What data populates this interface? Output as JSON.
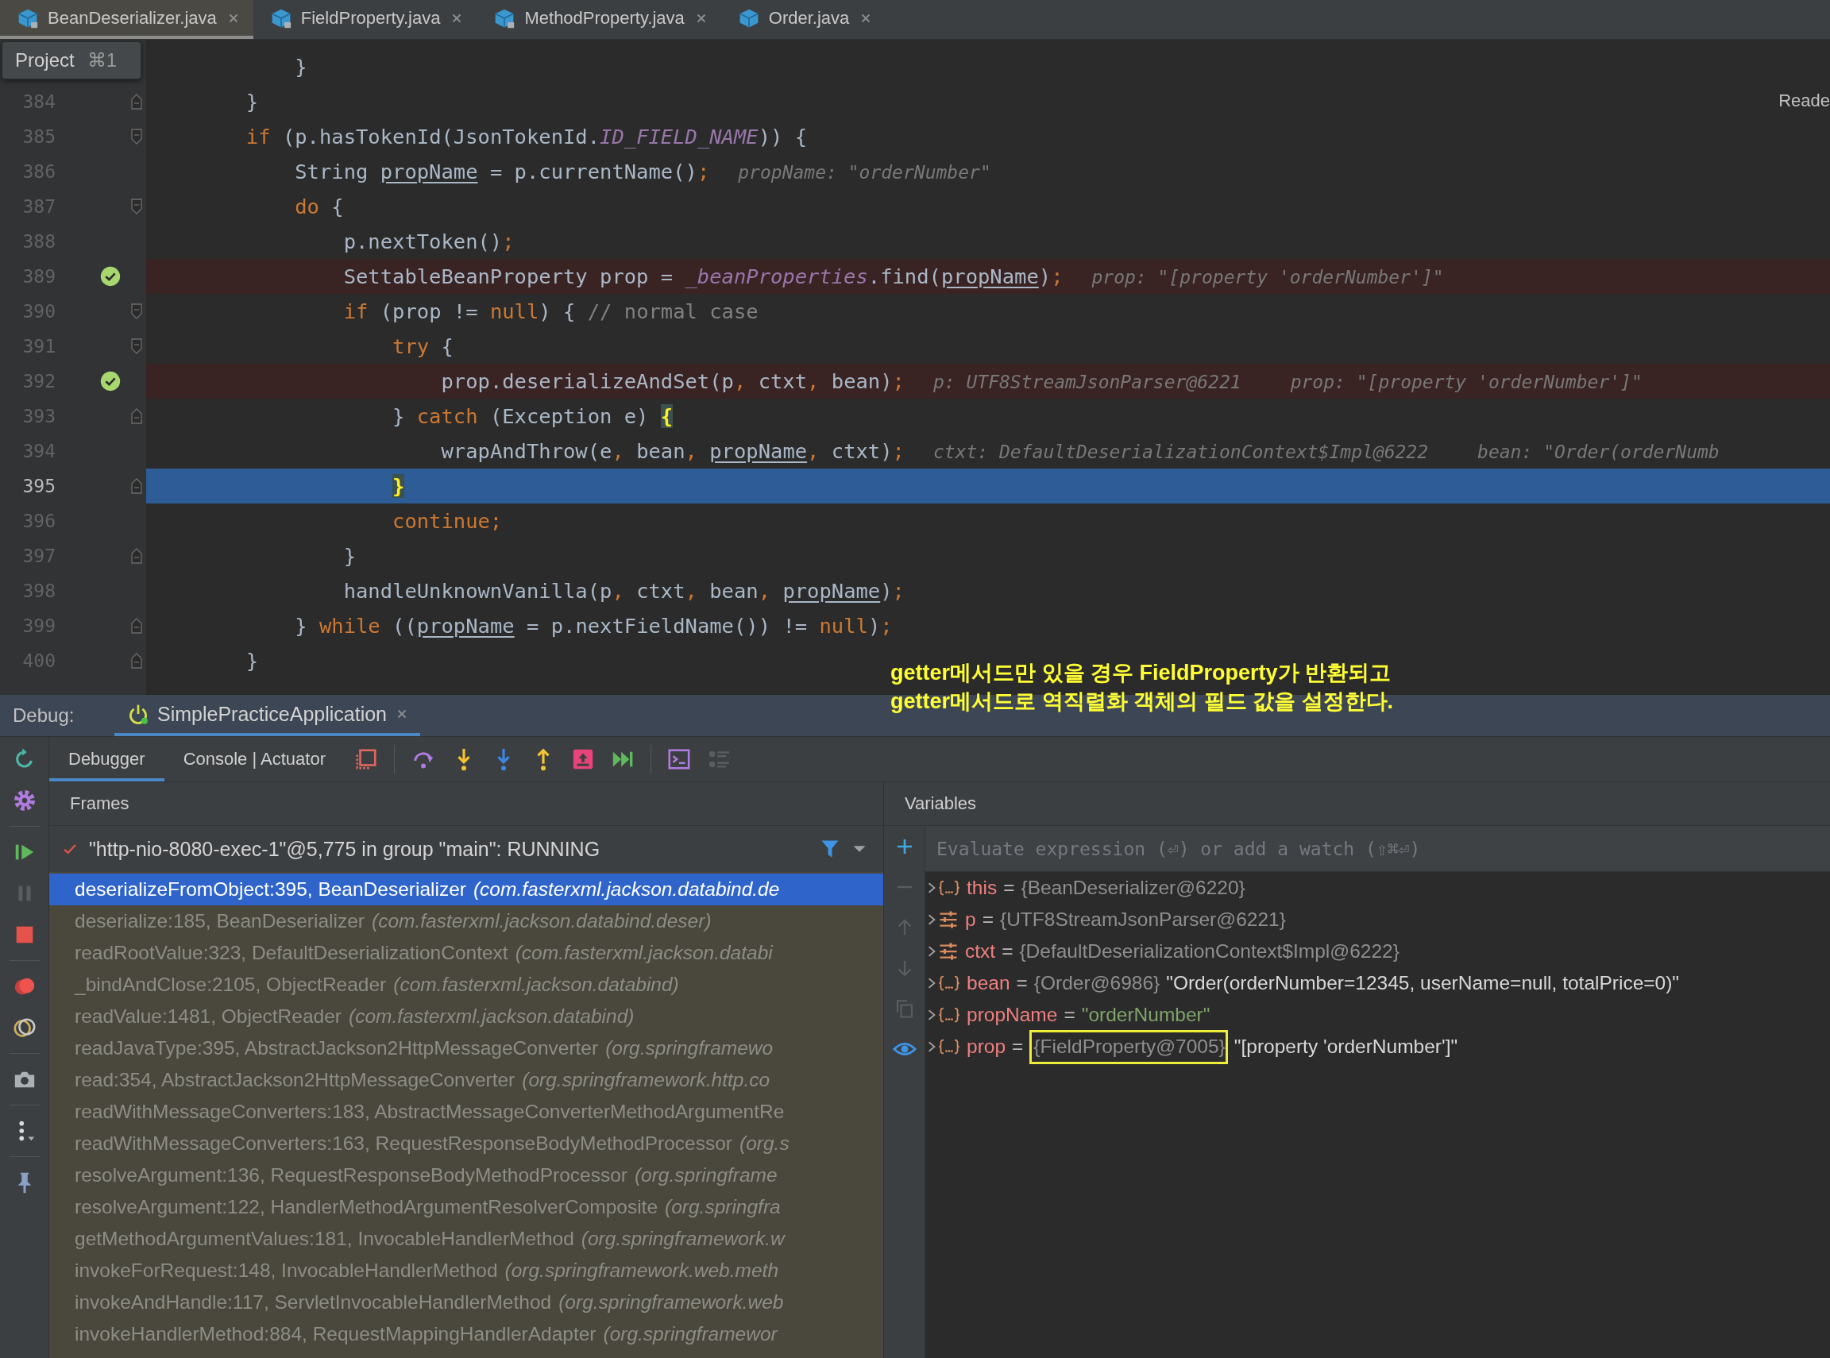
{
  "tabs": [
    {
      "label": "BeanDeserializer.java",
      "selected": true,
      "locked": true
    },
    {
      "label": "FieldProperty.java",
      "selected": false,
      "locked": true
    },
    {
      "label": "MethodProperty.java",
      "selected": false,
      "locked": true
    },
    {
      "label": "Order.java",
      "selected": false,
      "locked": false
    }
  ],
  "tooltip": {
    "label": "Project",
    "shortcut": "⌘1"
  },
  "reader_mode": "Reade",
  "code_lines": [
    {
      "breakpoint": false,
      "current": false,
      "segments": [
        {
          "kind": "plain",
          "text": "            }"
        }
      ]
    },
    {
      "number": "384",
      "fold": {
        "kind": "end"
      },
      "breakpoint": false,
      "current": false,
      "segments": [
        {
          "kind": "plain",
          "text": "        }"
        }
      ]
    },
    {
      "number": "385",
      "fold": {
        "kind": "start"
      },
      "breakpoint": false,
      "current": false,
      "segments": [
        {
          "kind": "keyword",
          "text": "        if"
        },
        {
          "kind": "plain",
          "text": " (p.hasTokenId(JsonTokenId."
        },
        {
          "kind": "static",
          "text": "ID_FIELD_NAME"
        },
        {
          "kind": "plain",
          "text": ")) {"
        }
      ]
    },
    {
      "number": "386",
      "breakpoint": false,
      "current": false,
      "segments": [
        {
          "kind": "plain",
          "text": "            String "
        },
        {
          "kind": "underlined",
          "text": "propName"
        },
        {
          "kind": "plain",
          "text": " = p.currentName()"
        },
        {
          "kind": "keyword",
          "text": ";"
        },
        {
          "kind": "hint",
          "text": "propName: \"orderNumber\""
        }
      ]
    },
    {
      "number": "387",
      "fold": {
        "kind": "start"
      },
      "breakpoint": false,
      "current": false,
      "segments": [
        {
          "kind": "keyword",
          "text": "            do"
        },
        {
          "kind": "plain",
          "text": " {"
        }
      ]
    },
    {
      "number": "388",
      "breakpoint": false,
      "current": false,
      "segments": [
        {
          "kind": "plain",
          "text": "                p.nextToken()"
        },
        {
          "kind": "keyword",
          "text": ";"
        }
      ]
    },
    {
      "number": "389",
      "breakpoint": true,
      "current": false,
      "segments": [
        {
          "kind": "plain",
          "text": "                SettableBeanProperty prop = "
        },
        {
          "kind": "static",
          "text": "_beanProperties"
        },
        {
          "kind": "plain",
          "text": ".find("
        },
        {
          "kind": "underlined",
          "text": "propName"
        },
        {
          "kind": "plain",
          "text": ")"
        },
        {
          "kind": "keyword",
          "text": ";"
        },
        {
          "kind": "hint",
          "text": "prop: \"[property 'orderNumber']\""
        }
      ]
    },
    {
      "number": "390",
      "fold": {
        "kind": "start"
      },
      "breakpoint": false,
      "current": false,
      "segments": [
        {
          "kind": "keyword",
          "text": "                if"
        },
        {
          "kind": "plain",
          "text": " (prop != "
        },
        {
          "kind": "keyword",
          "text": "null"
        },
        {
          "kind": "plain",
          "text": ") { "
        },
        {
          "kind": "comment",
          "text": "// normal case"
        }
      ]
    },
    {
      "number": "391",
      "fold": {
        "kind": "start"
      },
      "breakpoint": false,
      "current": false,
      "segments": [
        {
          "kind": "keyword",
          "text": "                    try"
        },
        {
          "kind": "plain",
          "text": " {"
        }
      ]
    },
    {
      "number": "392",
      "breakpoint": true,
      "current": false,
      "segments": [
        {
          "kind": "plain",
          "text": "                        prop.deserializeAndSet(p"
        },
        {
          "kind": "keyword",
          "text": ","
        },
        {
          "kind": "plain",
          "text": " ctxt"
        },
        {
          "kind": "keyword",
          "text": ","
        },
        {
          "kind": "plain",
          "text": " bean)"
        },
        {
          "kind": "keyword",
          "text": ";"
        },
        {
          "kind": "hint",
          "text": "p: UTF8StreamJsonParser@6221"
        },
        {
          "kind": "hint",
          "text": "prop: \"[property 'orderNumber']\""
        }
      ]
    },
    {
      "number": "393",
      "fold": {
        "kind": "end"
      },
      "breakpoint": false,
      "current": false,
      "segments": [
        {
          "kind": "plain",
          "text": "                    } "
        },
        {
          "kind": "keyword",
          "text": "catch"
        },
        {
          "kind": "plain",
          "text": " (Exception e) "
        },
        {
          "kind": "brace",
          "text": "{"
        }
      ]
    },
    {
      "number": "394",
      "breakpoint": false,
      "current": false,
      "segments": [
        {
          "kind": "plain",
          "text": "                        wrapAndThrow(e"
        },
        {
          "kind": "keyword",
          "text": ","
        },
        {
          "kind": "plain",
          "text": " bean"
        },
        {
          "kind": "keyword",
          "text": ","
        },
        {
          "kind": "underlined",
          "text": " propName"
        },
        {
          "kind": "keyword",
          "text": ","
        },
        {
          "kind": "plain",
          "text": " ctxt)"
        },
        {
          "kind": "keyword",
          "text": ";"
        },
        {
          "kind": "hint",
          "text": "ctxt: DefaultDeserializationContext$Impl@6222"
        },
        {
          "kind": "hint",
          "text": "bean: \"Order(orderNumb"
        }
      ]
    },
    {
      "number": "395",
      "fold": {
        "kind": "end"
      },
      "breakpoint": false,
      "current": true,
      "segments": [
        {
          "kind": "brace",
          "text": "                    }"
        }
      ]
    },
    {
      "number": "396",
      "breakpoint": false,
      "current": false,
      "segments": [
        {
          "kind": "keyword",
          "text": "                    continue;"
        }
      ]
    },
    {
      "number": "397",
      "fold": {
        "kind": "end"
      },
      "breakpoint": false,
      "current": false,
      "segments": [
        {
          "kind": "plain",
          "text": "                }"
        }
      ]
    },
    {
      "number": "398",
      "breakpoint": false,
      "current": false,
      "segments": [
        {
          "kind": "plain",
          "text": "                handleUnknownVanilla(p"
        },
        {
          "kind": "keyword",
          "text": ","
        },
        {
          "kind": "plain",
          "text": " ctxt"
        },
        {
          "kind": "keyword",
          "text": ","
        },
        {
          "kind": "plain",
          "text": " bean"
        },
        {
          "kind": "keyword",
          "text": ","
        },
        {
          "kind": "underlined",
          "text": " propName"
        },
        {
          "kind": "plain",
          "text": ")"
        },
        {
          "kind": "keyword",
          "text": ";"
        }
      ]
    },
    {
      "number": "399",
      "fold": {
        "kind": "end"
      },
      "breakpoint": false,
      "current": false,
      "segments": [
        {
          "kind": "plain",
          "text": "            } "
        },
        {
          "kind": "keyword",
          "text": "while"
        },
        {
          "kind": "plain",
          "text": " (("
        },
        {
          "kind": "underlined",
          "text": "propName"
        },
        {
          "kind": "plain",
          "text": " = p.nextFieldName()) != "
        },
        {
          "kind": "keyword",
          "text": "null"
        },
        {
          "kind": "plain",
          "text": ")"
        },
        {
          "kind": "keyword",
          "text": ";"
        }
      ]
    },
    {
      "number": "400",
      "fold": {
        "kind": "end"
      },
      "breakpoint": false,
      "current": false,
      "segments": [
        {
          "kind": "plain",
          "text": "        }"
        }
      ]
    }
  ],
  "annotation": [
    "getter메서드만 있을 경우 FieldProperty가 반환되고",
    "getter메서드로 역직렬화 객체의 필드 값을 설정한다."
  ],
  "debug": {
    "label": "Debug:",
    "session": "SimplePracticeApplication",
    "tabs": [
      {
        "label": "Debugger",
        "selected": true
      },
      {
        "label": "Console | Actuator",
        "selected": false
      }
    ]
  },
  "frames": {
    "title": "Frames",
    "thread": "\"http-nio-8080-exec-1\"@5,775 in group \"main\": RUNNING",
    "items": [
      {
        "method": "deserializeFromObject:395, BeanDeserializer",
        "package": "(com.fasterxml.jackson.databind.de",
        "selected": true
      },
      {
        "method": "deserialize:185, BeanDeserializer",
        "package": "(com.fasterxml.jackson.databind.deser)",
        "selected": false
      },
      {
        "method": "readRootValue:323, DefaultDeserializationContext",
        "package": "(com.fasterxml.jackson.databi",
        "selected": false
      },
      {
        "method": "_bindAndClose:2105, ObjectReader",
        "package": "(com.fasterxml.jackson.databind)",
        "selected": false
      },
      {
        "method": "readValue:1481, ObjectReader",
        "package": "(com.fasterxml.jackson.databind)",
        "selected": false
      },
      {
        "method": "readJavaType:395, AbstractJackson2HttpMessageConverter",
        "package": "(org.springframewo",
        "selected": false
      },
      {
        "method": "read:354, AbstractJackson2HttpMessageConverter",
        "package": "(org.springframework.http.co",
        "selected": false
      },
      {
        "method": "readWithMessageConverters:183, AbstractMessageConverterMethodArgumentRe",
        "selected": false
      },
      {
        "method": "readWithMessageConverters:163, RequestResponseBodyMethodProcessor",
        "package": "(org.s",
        "selected": false
      },
      {
        "method": "resolveArgument:136, RequestResponseBodyMethodProcessor",
        "package": "(org.springframe",
        "selected": false
      },
      {
        "method": "resolveArgument:122, HandlerMethodArgumentResolverComposite",
        "package": "(org.springfra",
        "selected": false
      },
      {
        "method": "getMethodArgumentValues:181, InvocableHandlerMethod",
        "package": "(org.springframework.w",
        "selected": false
      },
      {
        "method": "invokeForRequest:148, InvocableHandlerMethod",
        "package": "(org.springframework.web.meth",
        "selected": false
      },
      {
        "method": "invokeAndHandle:117, ServletInvocableHandlerMethod",
        "package": "(org.springframework.web",
        "selected": false
      },
      {
        "method": "invokeHandlerMethod:884, RequestMappingHandlerAdapter",
        "package": "(org.springframewor",
        "selected": false
      }
    ]
  },
  "variables": {
    "title": "Variables",
    "placeholder": "Evaluate expression (⏎) or add a watch (⇧⌘⏎)",
    "items": [
      {
        "kind": "object",
        "name": "this",
        "equals": "=",
        "ref": "{BeanDeserializer@6220}"
      },
      {
        "kind": "field",
        "name": "p",
        "equals": "=",
        "ref": "{UTF8StreamJsonParser@6221}"
      },
      {
        "kind": "field",
        "name": "ctxt",
        "equals": "=",
        "ref": "{DefaultDeserializationContext$Impl@6222}"
      },
      {
        "kind": "object",
        "name": "bean",
        "equals": "=",
        "ref": "{Order@6986}",
        "description": "\"Order(orderNumber=12345, userName=null, totalPrice=0)\""
      },
      {
        "kind": "object",
        "name": "propName",
        "equals": "=",
        "value": "\"orderNumber\""
      },
      {
        "kind": "object",
        "name": "prop",
        "equals": "=",
        "ref": "{FieldProperty@7005}",
        "description": "\"[property 'orderNumber']\"",
        "highlighted": true
      }
    ]
  }
}
